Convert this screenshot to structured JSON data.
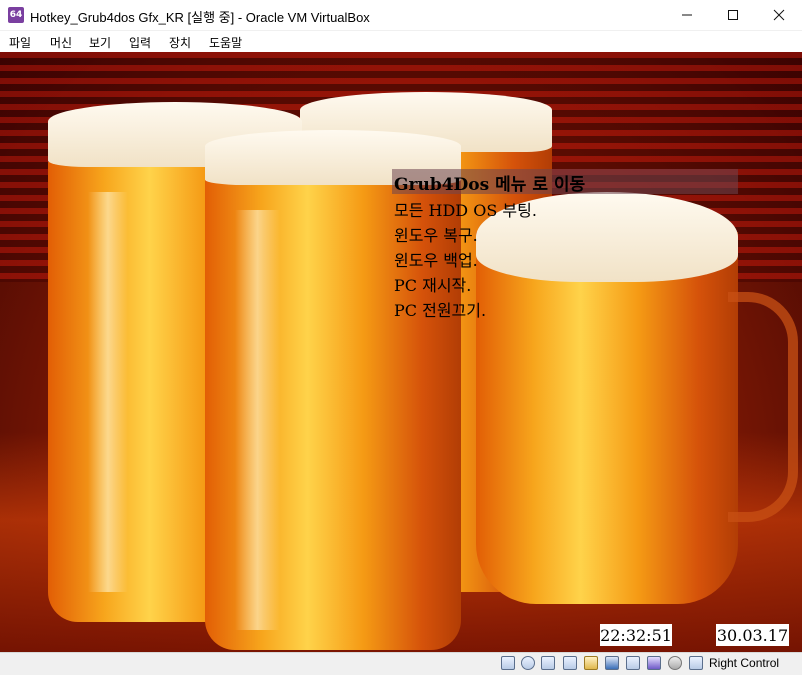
{
  "window": {
    "title": "Hotkey_Grub4dos Gfx_KR [실행 중] - Oracle VM VirtualBox",
    "app_icon_text": "64"
  },
  "menubar": {
    "items": [
      {
        "label": "파일"
      },
      {
        "label": "머신"
      },
      {
        "label": "보기"
      },
      {
        "label": "입력"
      },
      {
        "label": "장치"
      },
      {
        "label": "도움말"
      }
    ]
  },
  "boot_menu": {
    "header": "Grub4Dos 메뉴 로 이동",
    "items": [
      "모든 HDD OS 부팅.",
      "윈도우 복구.",
      "윈도우 백업.",
      "PC 재시작.",
      "PC 전원끄기."
    ]
  },
  "clock": {
    "time": "22:32:51",
    "date": "30.03.17"
  },
  "statusbar": {
    "icons": [
      "hard-disk-icon",
      "optical-drive-icon",
      "floppy-icon",
      "network-icon",
      "shared-folders-icon",
      "display-icon",
      "video-capture-icon",
      "usb-icon",
      "mouse-integration-icon",
      "download-arrow-icon"
    ],
    "host_key": "Right Control"
  },
  "colors": {
    "beer_orange": "#f59a14",
    "background_red": "#8a1c05",
    "menu_highlight": "#6e4650"
  }
}
